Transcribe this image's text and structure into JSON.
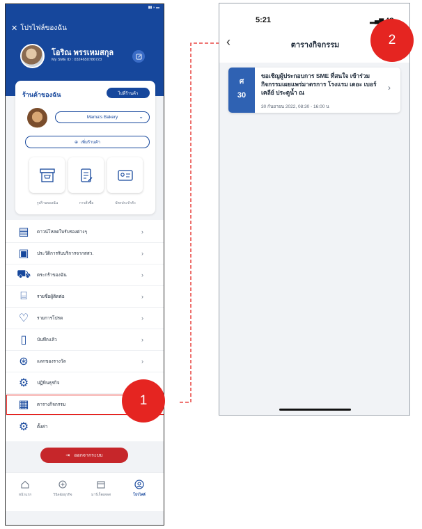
{
  "phone1": {
    "header": {
      "title": "โปรไฟล์ของฉัน",
      "user_name": "โอริณ พรรเหมสกุล",
      "user_id": "My SME ID : 0324650786723"
    },
    "shop": {
      "title": "ร้านค้าของฉัน",
      "link_button": "ไปที่ร้านค้า",
      "selected_shop": "Mama's Bakery",
      "add_shop": "เพิ่มร้านค้า",
      "tiles": [
        {
          "label": "รูปร้านของฉัน",
          "icon": "storefront-icon"
        },
        {
          "label": "การสั่งซื้อ",
          "icon": "order-list-icon"
        },
        {
          "label": "บัตรประจำตัว",
          "icon": "id-card-icon"
        }
      ]
    },
    "menu": [
      {
        "label": "ดาวน์โหลดใบรับรองต่างๆ",
        "icon": "certificate-icon",
        "chevron": true
      },
      {
        "label": "ประวัติการรับบริการจากสสว.",
        "icon": "history-icon",
        "chevron": true
      },
      {
        "label": "ตระกร้าของฉัน",
        "icon": "cart-icon",
        "chevron": true
      },
      {
        "label": "รายชื่อผู้ติดต่อ",
        "icon": "contacts-icon",
        "chevron": true
      },
      {
        "label": "รายการโปรด",
        "icon": "heart-icon",
        "chevron": true
      },
      {
        "label": "บันทึกแล้ว",
        "icon": "bookmark-icon",
        "chevron": true
      },
      {
        "label": "แลกของรางวัล",
        "icon": "reward-icon",
        "chevron": true
      },
      {
        "label": "ปฏิทินธุรกิจ",
        "icon": "calendar-gear-icon",
        "chevron": false
      },
      {
        "label": "ตารางกิจกรรม",
        "icon": "calendar-icon",
        "chevron": false
      },
      {
        "label": "ตั้งค่า",
        "icon": "gear-icon",
        "chevron": false
      }
    ],
    "logout_label": "ออกจากระบบ",
    "tabs": [
      {
        "label": "หน้าแรก",
        "icon": "home-icon",
        "active": false
      },
      {
        "label": "วินิจฉัยธุรกิจ",
        "icon": "diagnosis-icon",
        "active": false
      },
      {
        "label": "มาร์เก็ตเพลส",
        "icon": "market-icon",
        "active": false
      },
      {
        "label": "โปรไฟล์",
        "icon": "profile-icon",
        "active": true
      }
    ]
  },
  "callouts": {
    "one": "1",
    "two": "2"
  },
  "phone2": {
    "status_time": "5:21",
    "signal": "4G",
    "title": "ตารางกิจกรรม",
    "event": {
      "day_abbrev": "ศ",
      "day_num": "30",
      "title": "ขอเชิญผู้ประกอบการ SME ที่สนใจ เข้าร่วมกิจกรรมเผยแพร่มาตรการ โรงแรม เดอะ เบอร์เคลีย์ ประตูน้ำ ณ",
      "datetime": "30 กันยายน 2022, 08:30 - 16:00 น"
    }
  },
  "colors": {
    "brand": "#16479c",
    "accent": "#e52521",
    "logout": "#c6262a",
    "date_box": "#2f62b3"
  }
}
